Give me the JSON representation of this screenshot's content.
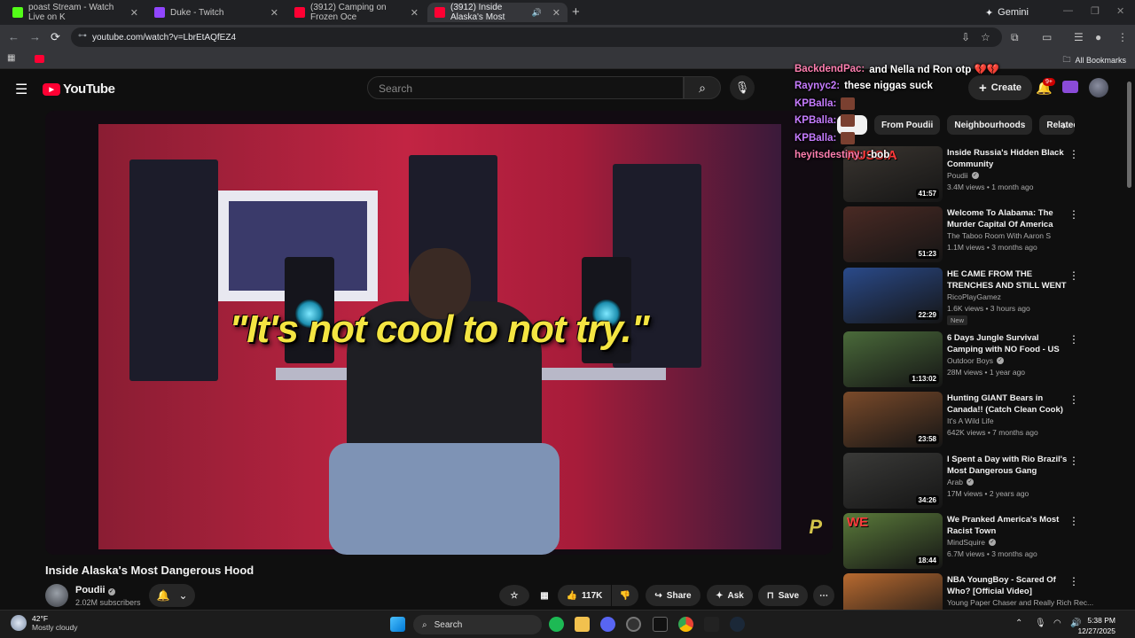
{
  "browser": {
    "tabs": [
      {
        "label": "poast Stream - Watch Live on K",
        "favicon_color": "#53fc18"
      },
      {
        "label": "Duke - Twitch",
        "favicon_color": "#9146ff"
      },
      {
        "label": "(3912) Camping on Frozen Oce",
        "favicon_color": "#ff0033"
      },
      {
        "label": "(3912) Inside Alaska's Most",
        "favicon_color": "#ff0033"
      }
    ],
    "gemini_label": "Gemini",
    "url": "youtube.com/watch?v=LbrEtAQfEZ4",
    "all_bookmarks": "All Bookmarks"
  },
  "youtube": {
    "logo_text": "YouTube",
    "search_placeholder": "Search",
    "create_label": "Create",
    "notification_count": "9+"
  },
  "chat_overlay": [
    {
      "user": "BackdendPac:",
      "message": "and Nella nd Ron otp 💔💔",
      "pink": true
    },
    {
      "user": "Raynyc2:",
      "message": "these niggas suck",
      "pink": false
    },
    {
      "user": "KPBalla:",
      "message": "",
      "pink": false
    },
    {
      "user": "KPBalla:",
      "message": "",
      "pink": false
    },
    {
      "user": "KPBalla:",
      "message": "",
      "pink": false
    },
    {
      "user": "heyitsdestiny: ",
      "message": "-bob",
      "pink": false
    }
  ],
  "video": {
    "caption": "\"It's not cool to not try.\"",
    "watermark": "P",
    "title": "Inside Alaska's Most Dangerous Hood",
    "channel": "Poudii",
    "subscribers": "2.02M subscribers",
    "likes": "117K",
    "share_label": "Share",
    "ask_label": "Ask",
    "save_label": "Save"
  },
  "chips": [
    "",
    "From Poudii",
    "Neighbourhoods",
    "Relatec"
  ],
  "recommendations": [
    {
      "title": "Inside Russia's Hidden Black Community",
      "channel": "Poudii",
      "verified": true,
      "meta": "3.4M views • 1 month ago",
      "duration": "41:57",
      "thumb_text": "RUSSIA",
      "thumb_color": "#3a3530",
      "is_new": false
    },
    {
      "title": "Welcome To Alabama: The Murder Capital Of America 2025",
      "channel": "The Taboo Room With Aaron S",
      "verified": false,
      "meta": "1.1M views • 3 months ago",
      "duration": "51:23",
      "thumb_text": "",
      "thumb_color": "#4a2a24",
      "is_new": false
    },
    {
      "title": "HE CAME FROM THE TRENCHES AND STILL WENT ...",
      "channel": "RicoPlayGamez",
      "verified": false,
      "meta": "1.6K views • 3 hours ago",
      "duration": "22:29",
      "thumb_text": "",
      "thumb_color": "#2a4a8a",
      "is_new": true,
      "new_label": "New"
    },
    {
      "title": "6 Days Jungle Survival Camping with NO Food - US Marine Cor...",
      "channel": "Outdoor Boys",
      "verified": true,
      "meta": "28M views • 1 year ago",
      "duration": "1:13:02",
      "thumb_text": "",
      "thumb_color": "#4a6a3a",
      "is_new": false
    },
    {
      "title": "Hunting GIANT Bears in Canada!! (Catch Clean Cook)",
      "channel": "It's A Wild Life",
      "verified": false,
      "meta": "642K views • 7 months ago",
      "duration": "23:58",
      "thumb_text": "",
      "thumb_color": "#7a4a2a",
      "is_new": false
    },
    {
      "title": "I Spent a Day with Rio Brazil's Most Dangerous Gang",
      "channel": "Arab",
      "verified": true,
      "meta": "17M views • 2 years ago",
      "duration": "34:26",
      "thumb_text": "",
      "thumb_color": "#3a3a38",
      "is_new": false
    },
    {
      "title": "We Pranked America's Most Racist Town",
      "channel": "MindSquire",
      "verified": true,
      "meta": "6.7M views • 3 months ago",
      "duration": "18:44",
      "thumb_text": "WE",
      "thumb_color": "#5a7a3a",
      "is_new": false
    },
    {
      "title": "NBA YoungBoy - Scared Of Who? [Official Video]",
      "channel": "Young Paper Chaser and Really Rich Rec...",
      "verified": false,
      "meta": "",
      "duration": "",
      "thumb_text": "",
      "thumb_color": "#b86a30",
      "is_new": false
    }
  ],
  "taskbar": {
    "temperature": "42°F",
    "weather": "Mostly cloudy",
    "search_label": "Search",
    "time": "5:38 PM",
    "date": "12/27/2025"
  }
}
